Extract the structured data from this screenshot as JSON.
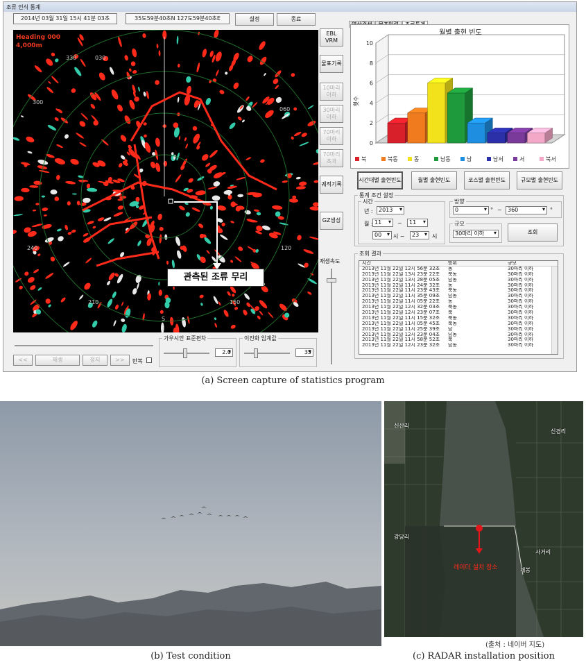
{
  "window": {
    "title": "조류 인식 통계"
  },
  "header": {
    "datetime": "2014년 03월 31일 15시 41분 03초",
    "position": "35도59분40초N 127도59분40초E",
    "settings_label": "설정",
    "exit_label": "종료"
  },
  "radar": {
    "heading": "Heading 000",
    "range": "4,000m",
    "bearings": [
      "330",
      "030",
      "060",
      "120",
      "150",
      "210",
      "240",
      "300"
    ],
    "south_marker": "S",
    "annotation": "관측된 조류 무리"
  },
  "radar_side_buttons": [
    "EBL VRM",
    "물표기록",
    "10마리 이하",
    "30마리 이하",
    "70마리 이하",
    "70마리 초과",
    "궤적기록",
    "GZ생성"
  ],
  "playback": {
    "speed_label": "재생속도",
    "prev_label": "<<",
    "play_label": "재생",
    "stop_label": "정지",
    "next_label": ">>",
    "repeat_label": "반복",
    "gauss_label": "가우시안 표준편차",
    "gauss_value": "2.0",
    "threshold_label": "이진화 임계값",
    "threshold_value": "35"
  },
  "tabs": [
    "영상검색",
    "물표입력",
    "조류통계"
  ],
  "chart_data": {
    "type": "bar",
    "title": "월별 출현 빈도",
    "ylabel": "횟수",
    "ylim": [
      0,
      10
    ],
    "yticks": [
      0,
      2,
      4,
      6,
      8,
      10
    ],
    "categories": [
      "북",
      "북동",
      "동",
      "남동",
      "남",
      "남서",
      "서",
      "북서"
    ],
    "values": [
      2,
      3,
      6,
      5,
      2,
      1,
      1,
      1
    ],
    "colors": [
      "#d8202a",
      "#f07a1e",
      "#f2e21c",
      "#1e9a3c",
      "#1e8ee0",
      "#2b2fa8",
      "#7a3a9a",
      "#f4a8c8"
    ],
    "grid": true,
    "legend": "bottom",
    "projection": "3d"
  },
  "stat_buttons": [
    "시간대별 출현빈도",
    "월별 출현빈도",
    "코스별 출현빈도",
    "규모별 출현빈도"
  ],
  "conditions": {
    "title": "통계 조건 설정",
    "time_label": "시간",
    "year_label": "년 :",
    "year_value": "2013",
    "month_label": "월 :",
    "month_from": "11",
    "month_tilde": "~",
    "month_to": "11",
    "hour_from": "00",
    "hour_sep": "시 ~",
    "hour_to": "23",
    "hour_unit": "시",
    "direction_label": "방향",
    "dir_from": "0",
    "dir_unit1": "°",
    "dir_tilde": "~",
    "dir_to": "360",
    "dir_unit2": "°",
    "scale_label": "규모",
    "scale_value": "30마리 이하",
    "query_label": "조회"
  },
  "results": {
    "title": "조회 결과",
    "headers": [
      "시간",
      "방위",
      "규모"
    ],
    "rows": [
      [
        "2013년 11월 22일 12시 56분 32초",
        "동",
        "30마리 이하"
      ],
      [
        "2013년 11월 22일 13시 23분 22초",
        "북동",
        "30마리 이하"
      ],
      [
        "2013년 11월 22일 13시 28분 05초",
        "남동",
        "30마리 이하"
      ],
      [
        "2013년 11월 22일 11시 24분 32초",
        "동",
        "30마리 이하"
      ],
      [
        "2013년 11월 22일 11시 23분 43초",
        "북동",
        "30마리 이하"
      ],
      [
        "2013년 11월 22일 11시 35분 09초",
        "남동",
        "30마리 이하"
      ],
      [
        "2013년 11월 22일 11시 05분 22초",
        "동",
        "30마리 이하"
      ],
      [
        "2013년 11월 22일 12시 32분 03초",
        "북동",
        "30마리 이하"
      ],
      [
        "2013년 11월 22일 12시 23분 07초",
        "북",
        "30마리 이하"
      ],
      [
        "2013년 11월 22일 11시 15분 32초",
        "북동",
        "30마리 이하"
      ],
      [
        "2013년 11월 22일 11시 05분 45초",
        "북동",
        "30마리 이하"
      ],
      [
        "2013년 11월 22일 11시 25분 39초",
        "남",
        "30마리 이하"
      ],
      [
        "2013년 11월 22일 12시 23분 04초",
        "남동",
        "30마리 이하"
      ],
      [
        "2013년 11월 22일 11시 58분 52초",
        "북",
        "30마리 이하"
      ],
      [
        "2013년 11월 22일 12시 23분 32초",
        "남동",
        "30마리 이하"
      ]
    ]
  },
  "captions": {
    "a": "(a) Screen capture of statistics program",
    "b": "(b) Test condition",
    "c": "(c) RADAR installation position"
  },
  "map": {
    "labels": [
      "신산리",
      "신경리",
      "강당리",
      "사거리",
      "개봉"
    ],
    "marker_label": "레이더 설치 장소",
    "source": "(출처 : 네이버 지도)"
  }
}
